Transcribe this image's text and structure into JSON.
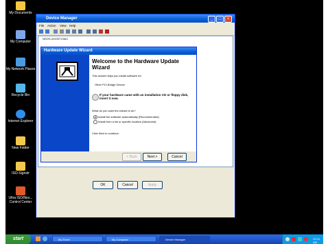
{
  "desktop": {
    "icons": [
      {
        "label": "My Documents",
        "icon": "my-documents-icon",
        "color": "#f4c842"
      },
      {
        "label": "My Computer",
        "icon": "my-computer-icon",
        "color": "#7da7e8"
      },
      {
        "label": "My Network Places",
        "icon": "network-places-icon",
        "color": "#4b9be0"
      },
      {
        "label": "Recycle Bin",
        "icon": "recycle-bin-icon",
        "color": "#56b6e8"
      },
      {
        "label": "Internet Explorer",
        "icon": "internet-explorer-icon",
        "color": "#2f8fe8"
      },
      {
        "label": "New Folder",
        "icon": "folder-icon",
        "color": "#f2c94c"
      },
      {
        "label": "ISO-Signstr",
        "icon": "folder-icon",
        "color": "#f2c94c"
      },
      {
        "label": "Ultra ISO/Nex... Control Center",
        "icon": "control-center-icon",
        "color": "#e05a2a"
      }
    ]
  },
  "device_manager": {
    "title": "Device Manager",
    "menu": [
      "File",
      "Action",
      "View",
      "Help"
    ],
    "tree_root": "NDOS-20100713IAC",
    "buttons": {
      "ok": "OK",
      "cancel": "Cancel",
      "apply": "Apply"
    }
  },
  "wizard": {
    "title": "Hardware Update Wizard",
    "heading": "Welcome to the Hardware Update Wizard",
    "intro": "This wizard helps you install software for:",
    "device": "Other PCI Bridge Device",
    "cd_hint": "If your hardware came with an installation CD or floppy disk, insert it now.",
    "question": "What do you want the wizard to do?",
    "options": [
      {
        "label": "Install the software automatically (Recommended)",
        "selected": true
      },
      {
        "label": "Install from a list or specific location (Advanced)",
        "selected": false
      }
    ],
    "continue": "Click Next to continue.",
    "buttons": {
      "back": "< Back",
      "next": "Next >",
      "cancel": "Cancel"
    }
  },
  "taskbar": {
    "start": "start",
    "tasks": [
      "My Event",
      "My Computer",
      "Device Manager"
    ],
    "clock": "10:14 AM"
  },
  "colors": {
    "title_bar": "#0a5cd7",
    "wizard_side": "#0a46c8",
    "taskbar": "#245dd8",
    "start": "#2f8a2f"
  }
}
